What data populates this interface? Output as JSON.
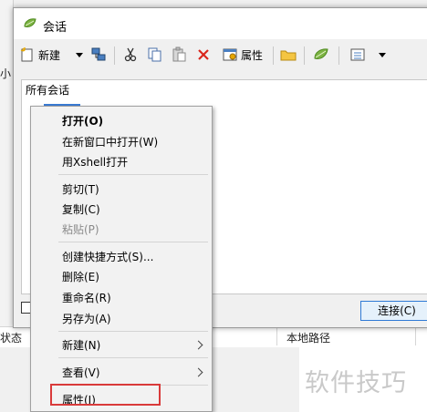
{
  "window": {
    "title": "会话"
  },
  "toolbar": {
    "new_label": "新建",
    "properties_label": "属性"
  },
  "tree": {
    "header": "所有会话"
  },
  "dialog_buttons": {
    "connect": "连接(C)"
  },
  "background": {
    "side_label": "小",
    "columns": {
      "status": "状态",
      "local_path": "本地路径"
    }
  },
  "context_menu": {
    "items": [
      {
        "label": "打开(O)",
        "bold": true
      },
      {
        "label": "在新窗口中打开(W)"
      },
      {
        "label": "用Xshell打开"
      },
      {
        "label": "剪切(T)"
      },
      {
        "label": "复制(C)"
      },
      {
        "label": "粘贴(P)",
        "disabled": true
      },
      {
        "label": "创建快捷方式(S)..."
      },
      {
        "label": "删除(E)"
      },
      {
        "label": "重命名(R)"
      },
      {
        "label": "另存为(A)"
      },
      {
        "label": "新建(N)",
        "submenu": true
      },
      {
        "label": "查看(V)",
        "submenu": true
      },
      {
        "label": "属性(I)",
        "highlighted": true
      }
    ]
  },
  "watermark": "软件技巧",
  "colors": {
    "highlight_border": "#d93a3a",
    "selection": "#3a7bd5",
    "icon_green": "#7cb342"
  }
}
